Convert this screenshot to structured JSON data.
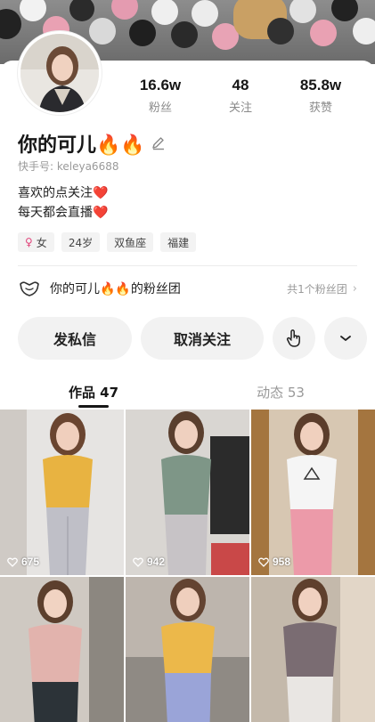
{
  "profile": {
    "name": "你的可儿🔥🔥",
    "kuaishou_id": "快手号: keleya6688",
    "bio_line1": "喜欢的点关注",
    "bio_line2": "每天都会直播",
    "heart": "❤️"
  },
  "stats": [
    {
      "value": "16.6w",
      "label": "粉丝"
    },
    {
      "value": "48",
      "label": "关注"
    },
    {
      "value": "85.8w",
      "label": "获赞"
    }
  ],
  "tags": {
    "gender": "女",
    "age": "24岁",
    "zodiac": "双鱼座",
    "region": "福建"
  },
  "fan_group": {
    "label": "你的可儿🔥🔥的粉丝团",
    "count": "共1个粉丝团"
  },
  "actions": {
    "message": "发私信",
    "unfollow": "取消关注"
  },
  "tabs": {
    "works": "作品 47",
    "moments": "动态 53"
  },
  "videos": [
    {
      "likes": "675"
    },
    {
      "likes": "942"
    },
    {
      "likes": "958"
    },
    {
      "likes": ""
    },
    {
      "likes": ""
    },
    {
      "likes": ""
    }
  ],
  "colors": {
    "accent_heart": "#e8323f",
    "female_symbol": "#e0447a"
  }
}
